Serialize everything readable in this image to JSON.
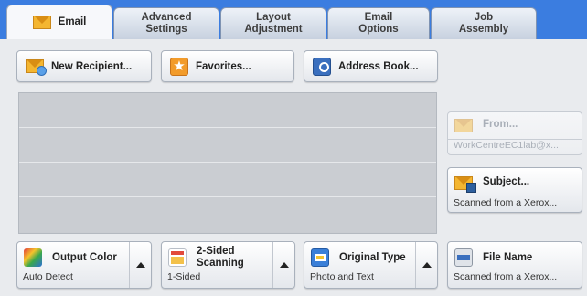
{
  "tabs": [
    {
      "label": "Email",
      "active": true
    },
    {
      "label": "Advanced\nSettings",
      "active": false
    },
    {
      "label": "Layout\nAdjustment",
      "active": false
    },
    {
      "label": "Email\nOptions",
      "active": false
    },
    {
      "label": "Job\nAssembly",
      "active": false
    }
  ],
  "actions": {
    "new_recipient": "New Recipient...",
    "favorites": "Favorites...",
    "address_book": "Address Book..."
  },
  "side": {
    "from_label": "From...",
    "from_value": "WorkCentreEC1lab@x...",
    "subject_label": "Subject...",
    "subject_value": "Scanned from a Xerox..."
  },
  "bottom": {
    "output_color_label": "Output Color",
    "output_color_value": "Auto Detect",
    "two_sided_label": "2-Sided\nScanning",
    "two_sided_value": "1-Sided",
    "original_type_label": "Original Type",
    "original_type_value": "Photo and Text",
    "file_name_label": "File Name",
    "file_name_value": "Scanned from a Xerox..."
  },
  "recipient_rows": 4,
  "colors": {
    "tab_bar": "#3b7de0",
    "envelope": "#f4b631",
    "star": "#f29b2a"
  }
}
